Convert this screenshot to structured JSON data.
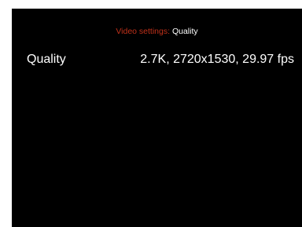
{
  "breadcrumb": {
    "parent": "Video settings:",
    "current": "Quality"
  },
  "setting": {
    "label": "Quality",
    "value": "2.7K, 2720x1530, 29.97 fps"
  },
  "colors": {
    "background": "#000000",
    "breadcrumb_parent": "#c0311a",
    "text": "#ffffff"
  }
}
